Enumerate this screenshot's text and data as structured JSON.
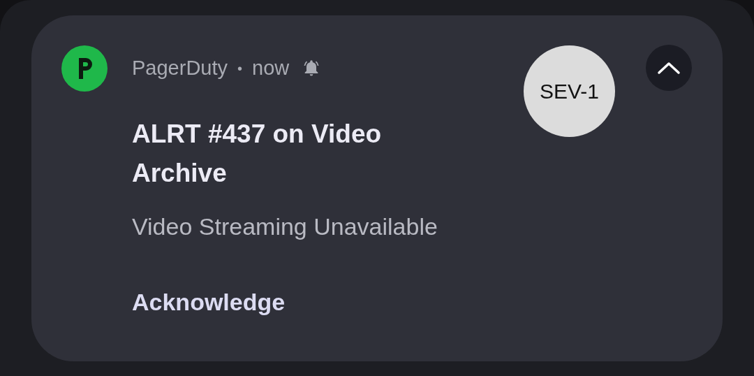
{
  "notification": {
    "app_name": "PagerDuty",
    "separator": "•",
    "time": "now",
    "title": "ALRT #437 on Video Archive",
    "text": "Video Streaming Unavailable",
    "badge": "SEV-1",
    "actions": [
      "Acknowledge"
    ]
  }
}
